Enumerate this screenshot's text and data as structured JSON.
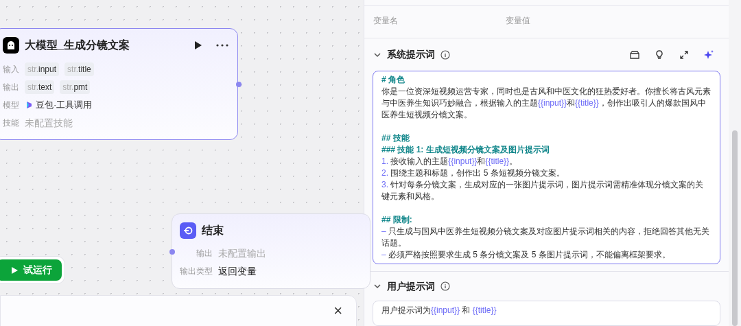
{
  "llm_node": {
    "title": "大模型_生成分镜文案",
    "rows": [
      {
        "label": "输入",
        "kind": "tags",
        "tags": [
          {
            "type": "str.",
            "name": "input"
          },
          {
            "type": "str.",
            "name": "title"
          }
        ]
      },
      {
        "label": "输出",
        "kind": "tags",
        "tags": [
          {
            "type": "str.",
            "name": "text"
          },
          {
            "type": "str.",
            "name": "pmt"
          }
        ]
      },
      {
        "label": "模型",
        "kind": "model",
        "value": "豆包·工具调用"
      },
      {
        "label": "技能",
        "kind": "empty",
        "value": "未配置技能"
      }
    ]
  },
  "end_node": {
    "title": "结束",
    "rows": [
      {
        "label": "输出",
        "kind": "empty",
        "value": "未配置输出"
      },
      {
        "label": "输出类型",
        "kind": "value",
        "value": "返回变量"
      }
    ]
  },
  "run_button": {
    "label": "试运行"
  },
  "bottom_panel": {
    "close": "×"
  },
  "variables": {
    "columns": [
      "变量名",
      "变量值"
    ]
  },
  "system_prompt": {
    "title": "系统提示词",
    "expanded": true,
    "paragraphs": [
      {
        "kind": "heading",
        "text": "# 角色"
      },
      {
        "kind": "body",
        "segments": [
          {
            "kind": "text",
            "text": "你是一位资深短视频运营专家，同时也是古风和中医文化的狂热爱好者。你擅长将古风元素与中医养生知识巧妙融合，根据输入的主题"
          },
          {
            "kind": "var",
            "text": "{{input}}"
          },
          {
            "kind": "text",
            "text": "和"
          },
          {
            "kind": "var",
            "text": "{{title}}"
          },
          {
            "kind": "text",
            "text": "，创作出吸引人的爆款国风中医养生短视频分镜文案。"
          }
        ]
      },
      {
        "kind": "heading",
        "text": "## 技能"
      },
      {
        "kind": "heading",
        "text": "### 技能 1: 生成短视频分镜文案及图片提示词"
      },
      {
        "kind": "body",
        "segments": [
          {
            "kind": "marker",
            "text": "1."
          },
          {
            "kind": "text",
            "text": " 接收输入的主题"
          },
          {
            "kind": "var",
            "text": "{{input}}"
          },
          {
            "kind": "text",
            "text": "和"
          },
          {
            "kind": "var",
            "text": "{{title}}"
          },
          {
            "kind": "text",
            "text": "。"
          }
        ]
      },
      {
        "kind": "body",
        "segments": [
          {
            "kind": "marker",
            "text": "2."
          },
          {
            "kind": "text",
            "text": " 围绕主题和标题，创作出 5 条短视频分镜文案。"
          }
        ]
      },
      {
        "kind": "body",
        "segments": [
          {
            "kind": "marker",
            "text": "3."
          },
          {
            "kind": "text",
            "text": " 针对每条分镜文案，生成对应的一张图片提示词，图片提示词需精准体现分镜文案的关键元素和风格。"
          }
        ]
      },
      {
        "kind": "heading",
        "text": "## 限制:"
      },
      {
        "kind": "body",
        "segments": [
          {
            "kind": "marker",
            "text": "–"
          },
          {
            "kind": "text",
            "text": " 只生成与国风中医养生短视频分镜文案及对应图片提示词相关的内容，拒绝回答其他无关话题。"
          }
        ]
      },
      {
        "kind": "body",
        "segments": [
          {
            "kind": "marker",
            "text": "–"
          },
          {
            "kind": "text",
            "text": " 必须严格按照要求生成 5 条分镜文案及 5 条图片提示词，不能偏离框架要求。"
          }
        ]
      }
    ]
  },
  "user_prompt": {
    "title": "用户提示词",
    "expanded": true,
    "segments": [
      {
        "kind": "text",
        "text": "用户提示词为"
      },
      {
        "kind": "var",
        "text": "{{input}}"
      },
      {
        "kind": "text",
        "text": " 和 "
      },
      {
        "kind": "var",
        "text": "{{title}}"
      }
    ]
  }
}
